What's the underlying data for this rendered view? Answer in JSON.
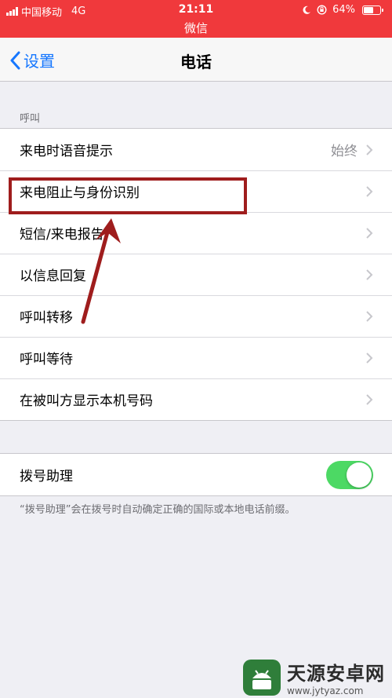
{
  "status_bar": {
    "carrier": "中国移动",
    "network": "4G",
    "time": "21:11",
    "battery_percent": "64%",
    "battery_level": 0.64,
    "return_app": "微信",
    "icons": [
      "signal-icon",
      "moon-icon",
      "rotation-lock-icon",
      "battery-icon"
    ]
  },
  "nav": {
    "back_label": "设置",
    "title": "电话"
  },
  "section_call": {
    "header": "呼叫",
    "rows": [
      {
        "label": "来电时语音提示",
        "value": "始终"
      },
      {
        "label": "来电阻止与身份识别",
        "value": ""
      },
      {
        "label": "短信/来电报告",
        "value": ""
      },
      {
        "label": "以信息回复",
        "value": ""
      },
      {
        "label": "呼叫转移",
        "value": ""
      },
      {
        "label": "呼叫等待",
        "value": ""
      },
      {
        "label": "在被叫方显示本机号码",
        "value": ""
      }
    ]
  },
  "dial_assist": {
    "label": "拨号助理",
    "enabled": true,
    "footnote": "“拨号助理”会在拨号时自动确定正确的国际或本地电话前缀。"
  },
  "annotation": {
    "color": "#9f1d1d",
    "target": "来电阻止与身份识别"
  },
  "watermark": {
    "title": "天源安卓网",
    "url": "www.jytyaz.com"
  },
  "colors": {
    "status_bar": "#f0393c",
    "accent": "#1677ff",
    "toggle_on": "#4cd964"
  }
}
